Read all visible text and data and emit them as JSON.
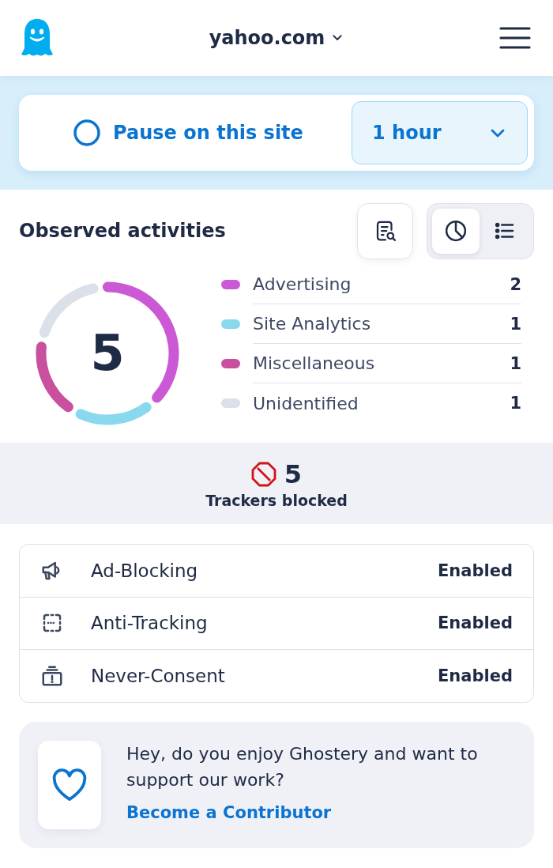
{
  "header": {
    "site": "yahoo.com"
  },
  "pause": {
    "label": "Pause on this site",
    "duration": "1 hour"
  },
  "activities": {
    "title": "Observed activities",
    "view_buttons": [
      {
        "selected": true
      },
      {
        "selected": false
      }
    ],
    "total": "5",
    "chart_data": {
      "type": "donut",
      "categories": [
        "Advertising",
        "Site Analytics",
        "Miscellaneous",
        "Unidentified"
      ],
      "values": [
        40,
        20,
        20,
        20
      ],
      "legend": "right"
    },
    "legend": [
      {
        "count": "2",
        "color": "#cb58d4"
      },
      {
        "count": "1",
        "color": "#88d8ee"
      },
      {
        "count": "1",
        "color": "#c8509e"
      },
      {
        "count": "1",
        "color": "#dce0e8"
      }
    ]
  },
  "blocked": {
    "count": "5",
    "label": "Trackers blocked"
  },
  "features": [
    {
      "label": "Ad-Blocking",
      "status": "Enabled"
    },
    {
      "label": "Anti-Tracking",
      "status": "Enabled"
    },
    {
      "label": "Never-Consent",
      "status": "Enabled"
    }
  ],
  "contribute": {
    "message": "Hey, do you enjoy Ghostery and want to support our work?",
    "link": "Become a Contributor"
  }
}
